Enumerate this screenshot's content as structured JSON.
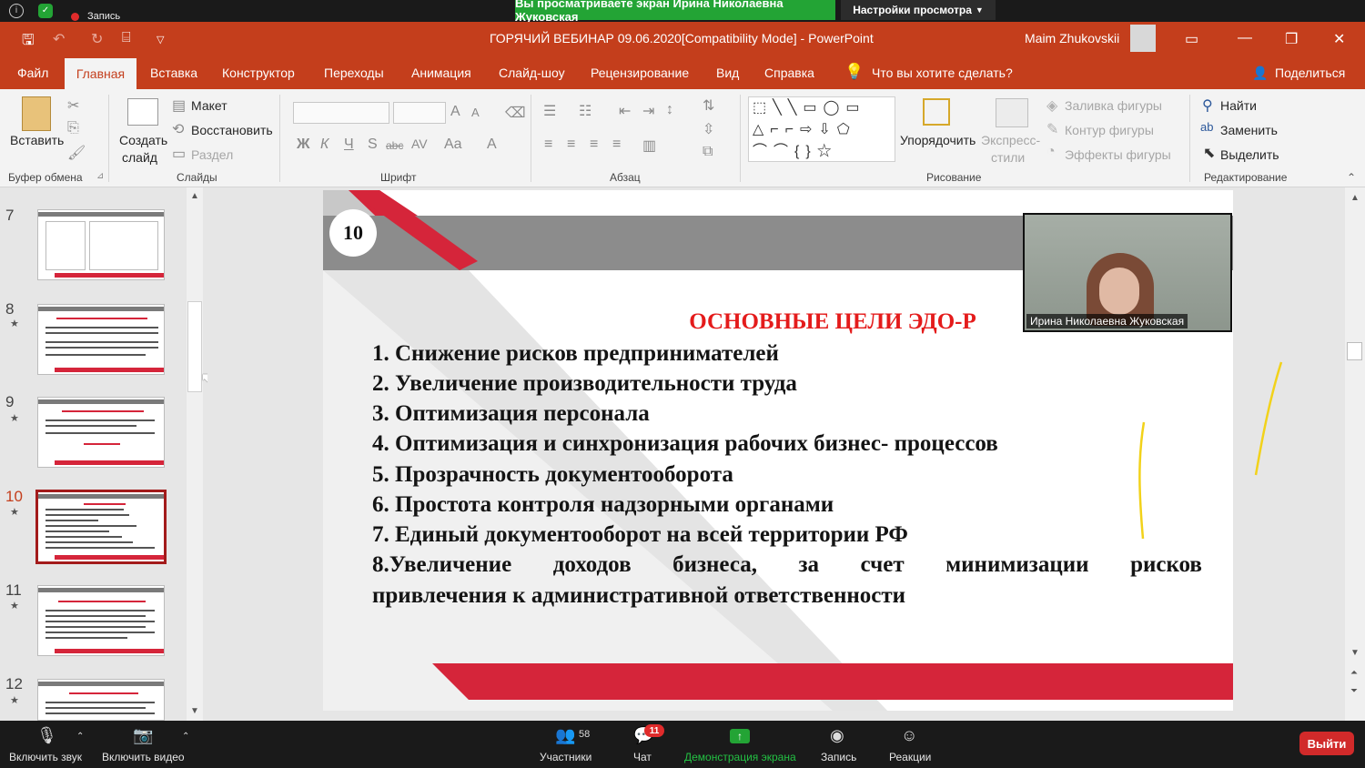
{
  "zoom": {
    "recording_label": "Запись",
    "share_banner": "Вы просматриваете экран Ирина Николаевна Жуковская",
    "view_options": "Настройки просмотра",
    "bottom": {
      "mute": "Включить звук",
      "video": "Включить видео",
      "participants": "Участники",
      "participants_count": "58",
      "chat": "Чат",
      "chat_badge": "11",
      "share": "Демонстрация экрана",
      "record": "Запись",
      "reactions": "Реакции",
      "leave": "Выйти"
    },
    "video_name": "Ирина Николаевна Жуковская"
  },
  "ppt": {
    "title": "ГОРЯЧИЙ ВЕБИНАР 09.06.2020[Compatibility Mode]  -  PowerPoint",
    "user": "Maim Zhukovskii",
    "tabs": [
      "Файл",
      "Главная",
      "Вставка",
      "Конструктор",
      "Переходы",
      "Анимация",
      "Слайд-шоу",
      "Рецензирование",
      "Вид",
      "Справка"
    ],
    "tell_me": "Что вы хотите сделать?",
    "share": "Поделиться",
    "ribbon": {
      "paste": "Вставить",
      "clipboard": "Буфер обмена",
      "new_slide_1": "Создать",
      "new_slide_2": "слайд",
      "layout": "Макет",
      "reset": "Восстановить",
      "section": "Раздел",
      "slides": "Слайды",
      "font": "Шрифт",
      "paragraph": "Абзац",
      "arrange": "Упорядочить",
      "quick_styles_1": "Экспресс-",
      "quick_styles_2": "стили",
      "shape_fill": "Заливка фигуры",
      "shape_outline": "Контур фигуры",
      "shape_effects": "Эффекты фигуры",
      "drawing": "Рисование",
      "find": "Найти",
      "replace": "Заменить",
      "select": "Выделить",
      "editing": "Редактирование",
      "font_buttons": [
        "Ж",
        "К",
        "Ч",
        "S",
        "abc",
        "AV",
        "Aa",
        "A"
      ]
    },
    "thumb_numbers": [
      "7",
      "8",
      "9",
      "10",
      "11",
      "12"
    ],
    "slide": {
      "number": "10",
      "heading": "ОСНОВНЫЕ ЦЕЛИ ЭДО-Р",
      "goals": [
        "1. Снижение рисков предпринимателей",
        "2. Увеличение производительности труда",
        "3. Оптимизация персонала",
        "4. Оптимизация и синхронизация рабочих бизнес- процессов",
        "5. Прозрачность документооборота",
        "6. Простота контроля надзорными органами",
        "7. Единый документооборот на всей территории РФ"
      ],
      "goal8_words": [
        "8.Увеличение",
        "доходов",
        "бизнеса,",
        "за",
        "счет",
        "минимизации",
        "рисков"
      ],
      "goal8_line2": "привлечения к административной ответственности"
    }
  },
  "colors": {
    "ppt_red": "#c43e1c",
    "slide_red": "#d5253a",
    "zoom_green": "#23a435"
  }
}
